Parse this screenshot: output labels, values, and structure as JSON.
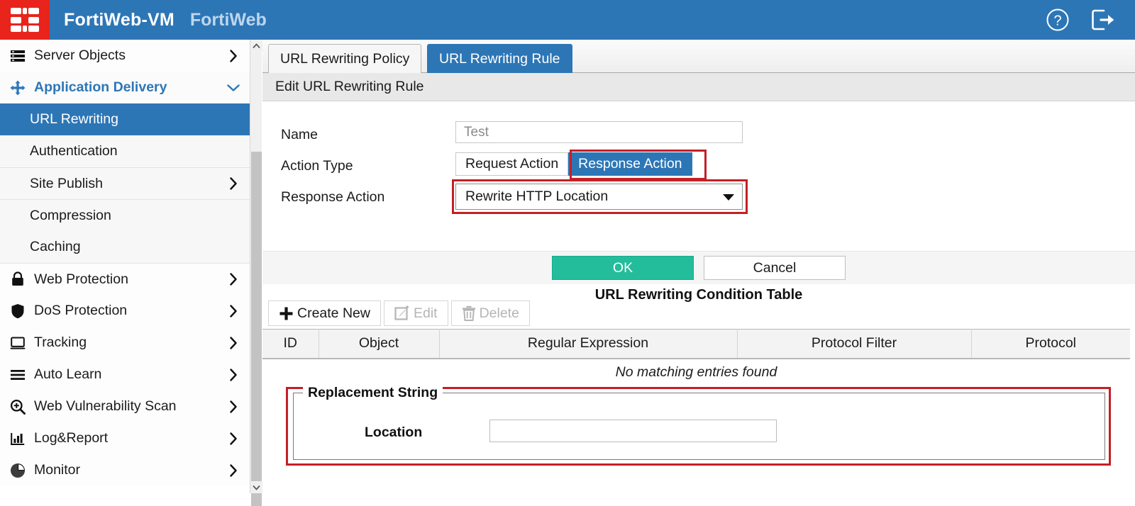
{
  "header": {
    "product": "FortiWeb-VM",
    "suite": "FortiWeb",
    "logo_icon": "fortinet-logo-icon",
    "help_icon": "help-circle-icon",
    "logout_icon": "logout-icon",
    "bg_color": "#2D76B6",
    "logo_color": "#E8241C"
  },
  "sidebar": {
    "items": [
      {
        "label": "Server Objects",
        "icon": "server-stack-icon",
        "caret": "chevron-right",
        "level": "top",
        "state": "normal"
      },
      {
        "label": "Application Delivery",
        "icon": "move-arrows-icon",
        "caret": "chevron-down",
        "level": "top",
        "state": "expanded"
      },
      {
        "label": "URL Rewriting",
        "icon": "",
        "caret": "",
        "level": "child",
        "state": "active"
      },
      {
        "label": "Authentication",
        "icon": "",
        "caret": "",
        "level": "child",
        "state": "normal"
      },
      {
        "label": "Site Publish",
        "icon": "",
        "caret": "chevron-right",
        "level": "child",
        "state": "normal"
      },
      {
        "label": "Compression",
        "icon": "",
        "caret": "",
        "level": "child",
        "state": "normal"
      },
      {
        "label": "Caching",
        "icon": "",
        "caret": "",
        "level": "child",
        "state": "normal"
      },
      {
        "label": "Web Protection",
        "icon": "lock-icon",
        "caret": "chevron-right",
        "level": "top",
        "state": "normal"
      },
      {
        "label": "DoS Protection",
        "icon": "shield-icon",
        "caret": "chevron-right",
        "level": "top",
        "state": "normal"
      },
      {
        "label": "Tracking",
        "icon": "monitor-icon",
        "caret": "chevron-right",
        "level": "top",
        "state": "normal"
      },
      {
        "label": "Auto Learn",
        "icon": "hamburger-lines-icon",
        "caret": "chevron-right",
        "level": "top",
        "state": "normal"
      },
      {
        "label": "Web Vulnerability Scan",
        "icon": "magnifier-plus-icon",
        "caret": "chevron-right",
        "level": "top",
        "state": "normal"
      },
      {
        "label": "Log&Report",
        "icon": "bar-chart-icon",
        "caret": "chevron-right",
        "level": "top",
        "state": "normal"
      },
      {
        "label": "Monitor",
        "icon": "pie-chart-icon",
        "caret": "chevron-right",
        "level": "top",
        "state": "normal"
      }
    ],
    "active_color": "#2D76B6"
  },
  "tabs": [
    {
      "label": "URL Rewriting Policy",
      "active": false
    },
    {
      "label": "URL Rewriting Rule",
      "active": true
    }
  ],
  "subheader": {
    "title": "Edit URL Rewriting Rule"
  },
  "form": {
    "name": {
      "label": "Name",
      "value": "Test",
      "placeholder": ""
    },
    "action_type": {
      "label": "Action Type",
      "options": [
        "Request Action",
        "Response Action"
      ],
      "selected": "Response Action",
      "highlight_color": "#C32026"
    },
    "response_action": {
      "label": "Response Action",
      "selected": "Rewrite HTTP Location",
      "dropdown_icon": "chevron-down-icon",
      "highlight_color": "#C32026"
    }
  },
  "buttons": {
    "ok": "OK",
    "cancel": "Cancel",
    "ok_color": "#23BD9C"
  },
  "condition_table": {
    "title": "URL Rewriting Condition Table",
    "toolbar": [
      {
        "label": "Create New",
        "icon": "plus-icon",
        "disabled": false
      },
      {
        "label": "Edit",
        "icon": "pencil-icon",
        "disabled": true
      },
      {
        "label": "Delete",
        "icon": "trash-icon",
        "disabled": true
      }
    ],
    "columns": [
      "ID",
      "Object",
      "Regular Expression",
      "Protocol Filter",
      "Protocol"
    ],
    "rows": [],
    "empty_message": "No matching entries found"
  },
  "replacement_string": {
    "legend": "Replacement String",
    "location_label": "Location",
    "location_value": "",
    "highlight_color": "#C32026"
  },
  "scrollbar": {
    "up_icon": "chevron-up-icon",
    "down_icon": "chevron-down-icon"
  }
}
